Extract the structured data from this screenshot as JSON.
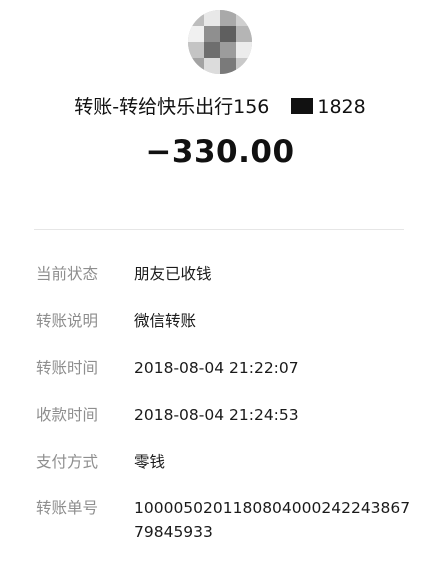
{
  "header": {
    "avatar_icon": "avatar-photo-icon",
    "title_prefix": "转账-转给快乐出行156",
    "title_suffix": "1828",
    "amount": "−330.00"
  },
  "details": [
    {
      "label": "当前状态",
      "value": "朋友已收钱"
    },
    {
      "label": "转账说明",
      "value": "微信转账"
    },
    {
      "label": "转账时间",
      "value": "2018-08-04 21:22:07"
    },
    {
      "label": "收款时间",
      "value": "2018-08-04 21:24:53"
    },
    {
      "label": "支付方式",
      "value": "零钱"
    },
    {
      "label": "转账单号",
      "value": "1000050201180804000242243867 79845933"
    }
  ],
  "colors": {
    "label_gray": "#8e8e8e",
    "text_dark": "#1a1a1a",
    "divider": "#e6e6e6"
  }
}
